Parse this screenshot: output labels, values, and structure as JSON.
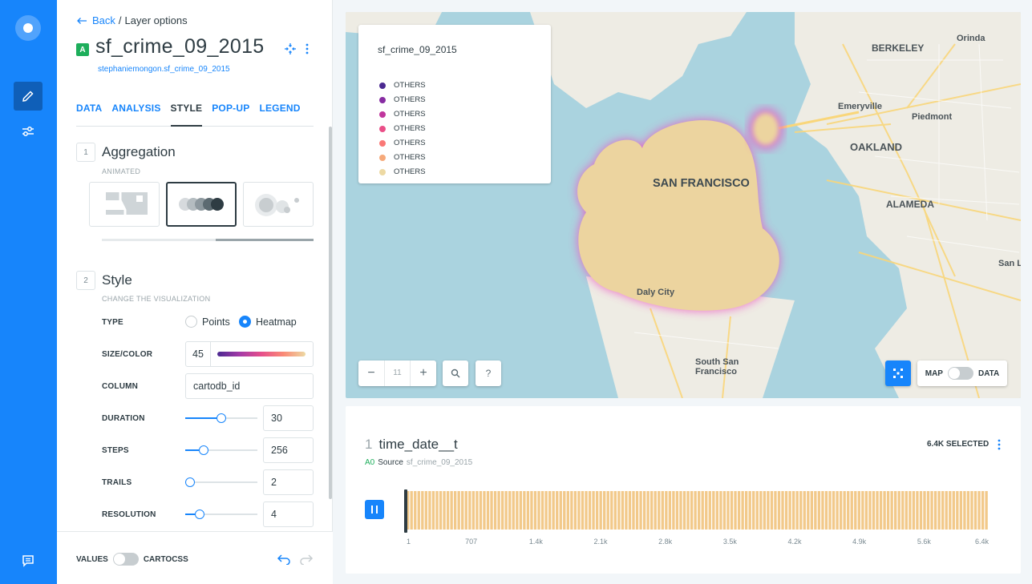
{
  "sidebar": {
    "items": [
      {
        "name": "edit",
        "icon": "pencil-icon"
      },
      {
        "name": "settings",
        "icon": "sliders-icon"
      }
    ],
    "chat_icon": "chat-icon"
  },
  "breadcrumb": {
    "back_label": "Back",
    "separator": "/",
    "current": "Layer options"
  },
  "layer": {
    "letter": "A",
    "title": "sf_crime_09_2015",
    "source": "stephaniemongon.sf_crime_09_2015"
  },
  "tabs": [
    {
      "label": "DATA"
    },
    {
      "label": "ANALYSIS"
    },
    {
      "label": "STYLE",
      "active": true
    },
    {
      "label": "POP-UP"
    },
    {
      "label": "LEGEND"
    }
  ],
  "aggregation": {
    "step": "1",
    "title": "Aggregation",
    "subtitle": "ANIMATED"
  },
  "style": {
    "step": "2",
    "title": "Style",
    "subtitle": "CHANGE THE VISUALIZATION",
    "type_label": "TYPE",
    "type_options": [
      "Points",
      "Heatmap"
    ],
    "type_selected": "Heatmap",
    "size_label": "SIZE/COLOR",
    "size_value": "45",
    "column_label": "COLUMN",
    "column_value": "cartodb_id",
    "duration_label": "DURATION",
    "duration_value": "30",
    "duration_level": 0.5,
    "steps_label": "STEPS",
    "steps_value": "256",
    "steps_level": 0.26,
    "trails_label": "TRAILS",
    "trails_value": "2",
    "trails_level": 0.07,
    "resolution_label": "RESOLUTION",
    "resolution_value": "4",
    "resolution_level": 0.2
  },
  "footer": {
    "values_label": "VALUES",
    "cartocss_label": "CARTOCSS"
  },
  "legend": {
    "title": "sf_crime_09_2015",
    "items": [
      {
        "label": "OTHERS",
        "color": "#4b2991"
      },
      {
        "label": "OTHERS",
        "color": "#872ca2"
      },
      {
        "label": "OTHERS",
        "color": "#c0369d"
      },
      {
        "label": "OTHERS",
        "color": "#ea4f88"
      },
      {
        "label": "OTHERS",
        "color": "#fa7876"
      },
      {
        "label": "OTHERS",
        "color": "#f6a97a"
      },
      {
        "label": "OTHERS",
        "color": "#edd9a3"
      }
    ]
  },
  "map": {
    "labels": {
      "orinda": "Orinda",
      "berkeley": "BERKELEY",
      "emeryville": "Emeryville",
      "piedmont": "Piedmont",
      "oakland": "OAKLAND",
      "alameda": "ALAMEDA",
      "san_francisco": "SAN FRANCISCO",
      "san_leandro": "San Lea",
      "daly_city": "Daly City",
      "south_sf": "South San Francisco"
    },
    "zoom": "11",
    "toggle_map": "MAP",
    "toggle_data": "DATA"
  },
  "widget": {
    "index": "1",
    "title": "time_date__t",
    "selected": "6.4K SELECTED",
    "source_id": "A0",
    "source_label": "Source",
    "source_name": "sf_crime_09_2015",
    "chart_data": {
      "type": "bar",
      "x": [
        "1",
        "707",
        "1.4k",
        "2.1k",
        "2.8k",
        "3.5k",
        "4.2k",
        "4.9k",
        "5.6k",
        "6.4k"
      ],
      "bar_count": 160,
      "bar_color": "#f2c98a"
    }
  },
  "colors": {
    "accent": "#1785fb",
    "brand_green": "#1dae5b",
    "heat_fill": "#ecd49f"
  }
}
